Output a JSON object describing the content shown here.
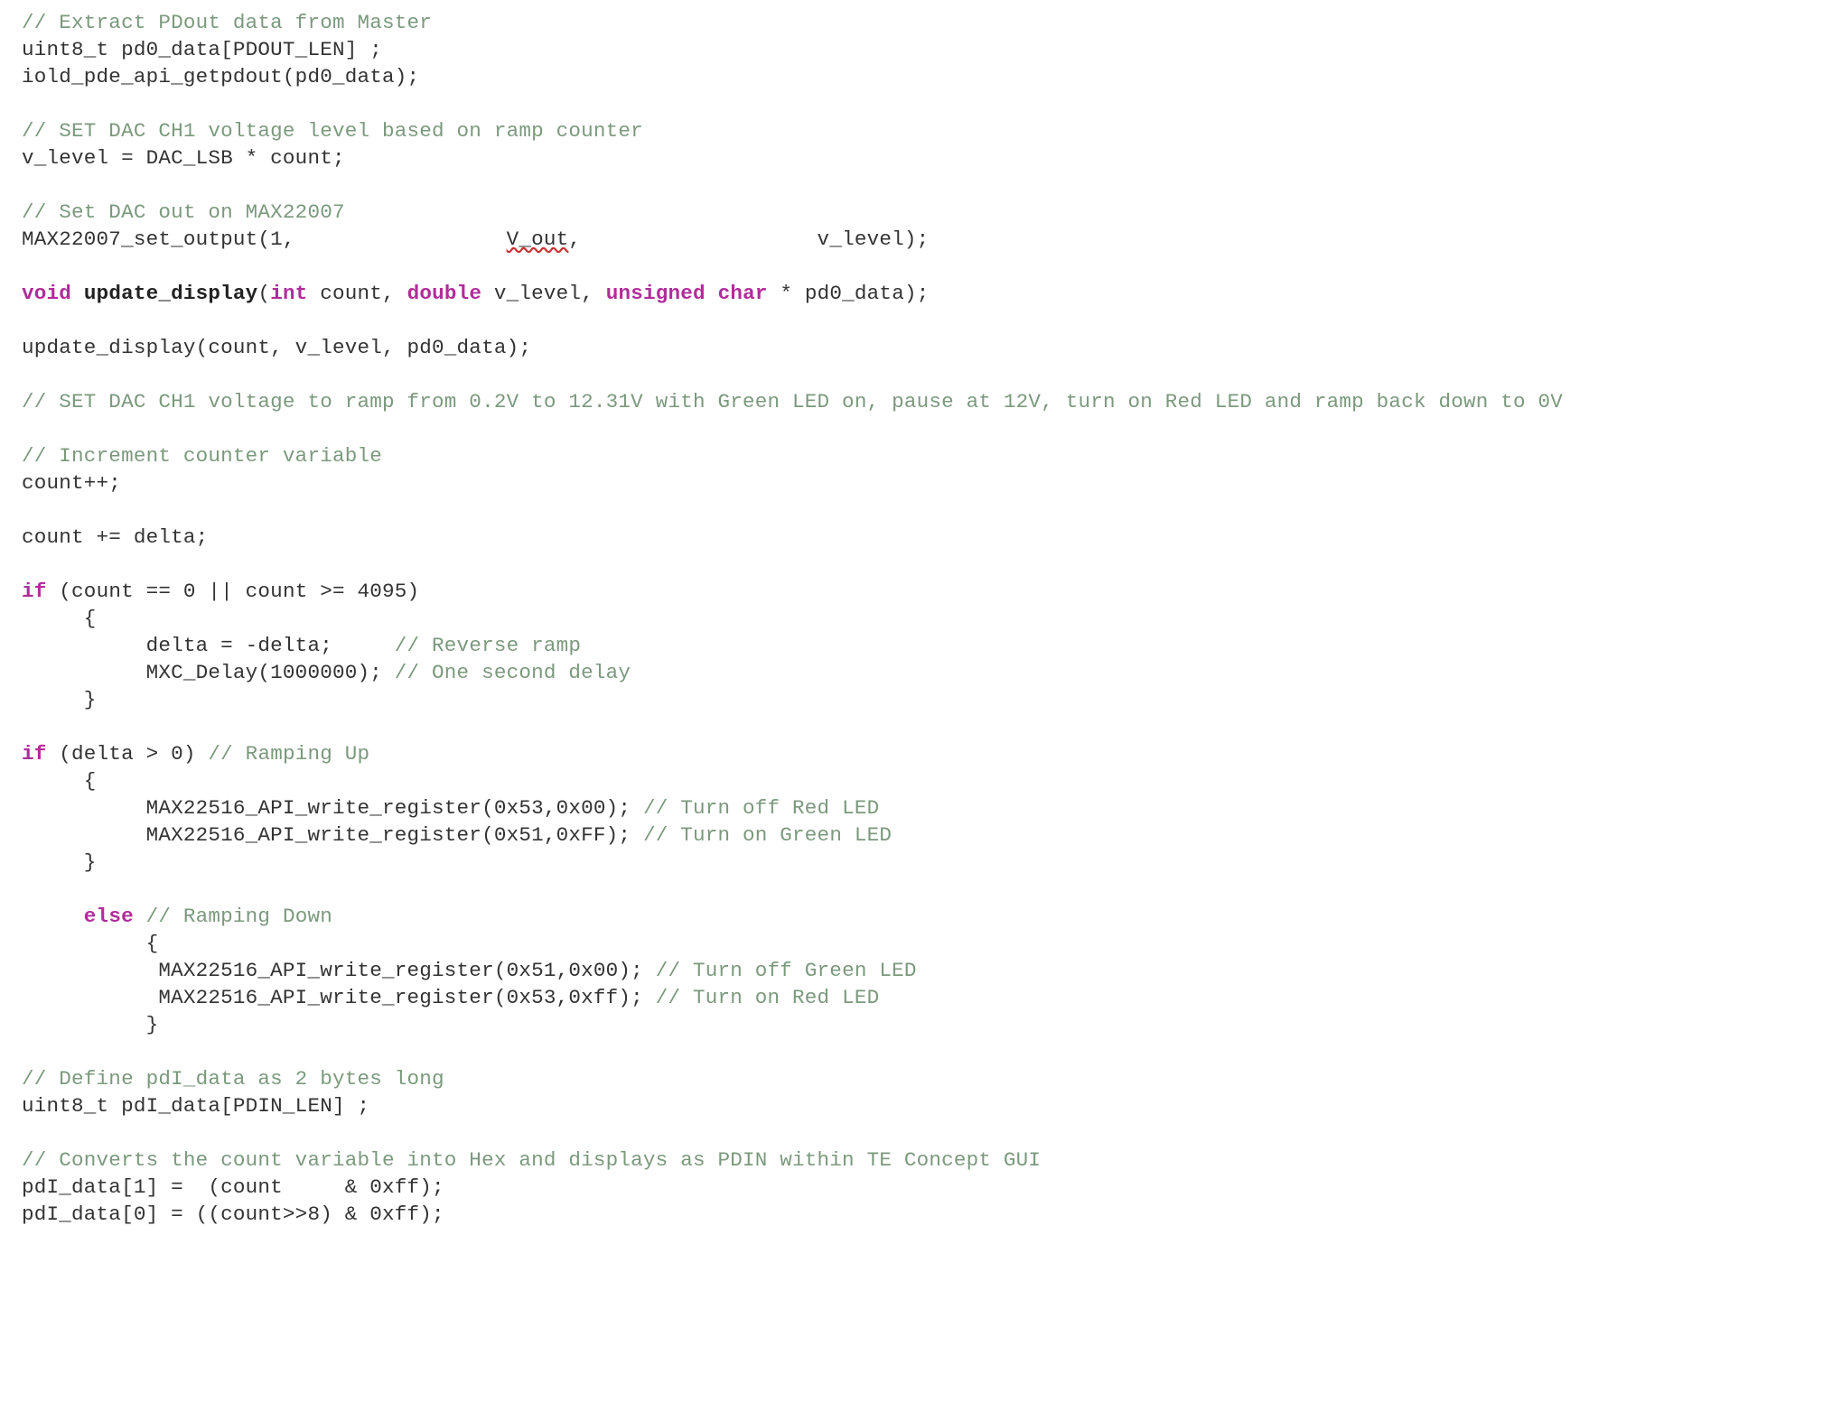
{
  "code": {
    "l01": {
      "c1": "// Extract PDout data from Master"
    },
    "l02": {
      "t1": "uint8_t pd0_data[PDOUT_LEN] ;"
    },
    "l03": {
      "t1": "iold_pde_api_getpdout(pd0_data);"
    },
    "l05": {
      "c1": "// SET DAC CH1 voltage level based on ramp counter"
    },
    "l06": {
      "t1": "v_level = DAC_LSB * count;"
    },
    "l08": {
      "c1": "// Set DAC out on MAX22007"
    },
    "l09": {
      "t1": "MAX22007_set_output(1,                 ",
      "u1": "V_out",
      "t2": ",                   v_level);"
    },
    "l11": {
      "k1": "void",
      "sp1": " ",
      "fn": "update_display",
      "t1": "(",
      "k2": "int",
      "t2": " count, ",
      "k3": "double",
      "t3": " v_level, ",
      "k4": "unsigned",
      "sp2": " ",
      "k5": "char",
      "t4": " * pd0_data);"
    },
    "l13": {
      "t1": "update_display(count, v_level, pd0_data);"
    },
    "l15": {
      "c1": "// SET DAC CH1 voltage to ramp from 0.2V to 12.31V with Green LED on, pause at 12V, turn on Red LED and ramp back down to 0V"
    },
    "l17": {
      "c1": "// Increment counter variable"
    },
    "l18": {
      "t1": "count++;"
    },
    "l20": {
      "t1": "count += delta;"
    },
    "l22": {
      "k1": "if",
      "t1": " (count == 0 || count >= 4095)"
    },
    "l23": {
      "t1": "     {"
    },
    "l24": {
      "t1": "          delta = -delta;     ",
      "c1": "// Reverse ramp"
    },
    "l25": {
      "t1": "          MXC_Delay(1000000); ",
      "c1": "// One second delay"
    },
    "l26": {
      "t1": "     }"
    },
    "l28": {
      "k1": "if",
      "t1": " (delta > 0) ",
      "c1": "// Ramping Up"
    },
    "l29": {
      "t1": "     {"
    },
    "l30": {
      "t1": "          MAX22516_API_write_register(0x53,0x00); ",
      "c1": "// Turn off Red LED"
    },
    "l31": {
      "t1": "          MAX22516_API_write_register(0x51,0xFF); ",
      "c1": "// Turn on Green LED"
    },
    "l32": {
      "t1": "     }"
    },
    "l34": {
      "t1": "     ",
      "k1": "else",
      "t2": " ",
      "c1": "// Ramping Down"
    },
    "l35": {
      "t1": "          {"
    },
    "l36": {
      "t1": "           MAX22516_API_write_register(0x51,0x00); ",
      "c1": "// Turn off Green LED"
    },
    "l37": {
      "t1": "           MAX22516_API_write_register(0x53,0xff); ",
      "c1": "// Turn on Red LED"
    },
    "l38": {
      "t1": "          }"
    },
    "l40": {
      "c1": "// Define pdI_data as 2 bytes long"
    },
    "l41": {
      "t1": "uint8_t pdI_data[PDIN_LEN] ;"
    },
    "l43": {
      "c1": "// Converts the count variable into Hex and displays as PDIN within TE Concept GUI"
    },
    "l44": {
      "t1": "pdI_data[1] =  (count     & 0xff);"
    },
    "l45": {
      "t1": "pdI_data[0] = ((count>>8) & 0xff);"
    }
  }
}
